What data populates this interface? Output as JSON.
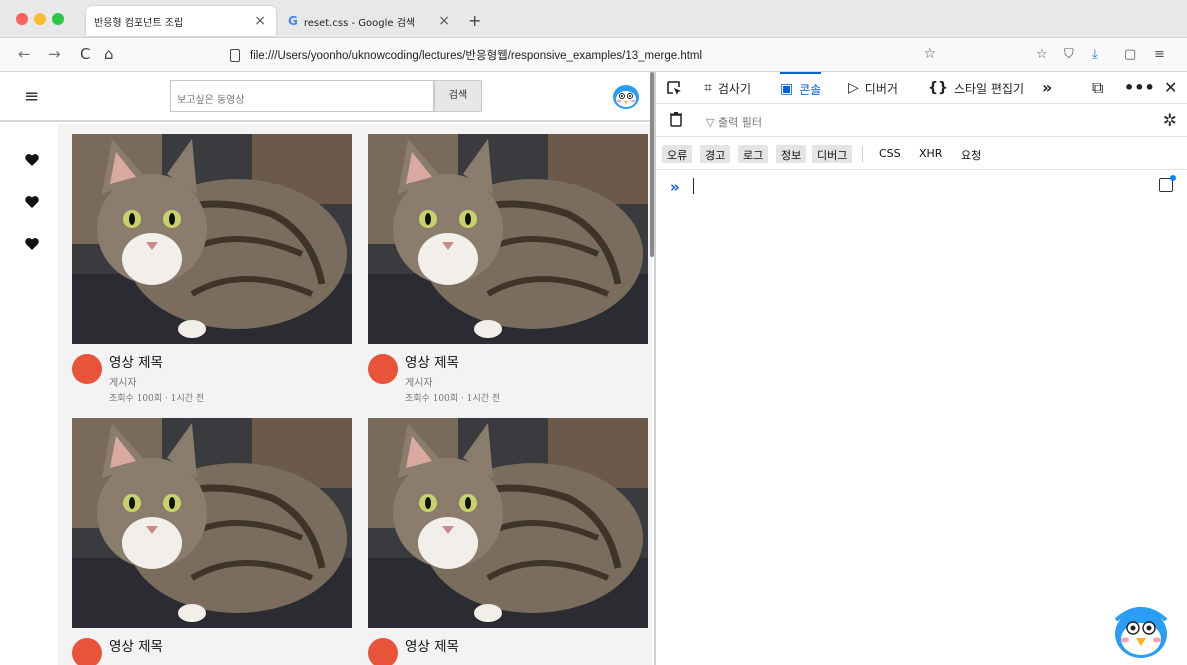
{
  "browser": {
    "tabs": [
      {
        "label": "반응형 컴포넌트 조립",
        "active": true
      },
      {
        "label": "reset.css - Google 검색",
        "active": false
      }
    ],
    "url": "file:///Users/yoonho/uknowcoding/lectures/반응형웹/responsive_examples/13_merge.html"
  },
  "page": {
    "search_placeholder": "보고싶은 동영상",
    "search_button": "검색",
    "cards": [
      {
        "title": "영상 제목",
        "author": "게시자",
        "info": "조회수 100회 · 1시간 전"
      },
      {
        "title": "영상 제목",
        "author": "게시자",
        "info": "조회수 100회 · 1시간 전"
      },
      {
        "title": "영상 제목",
        "author": "",
        "info": ""
      },
      {
        "title": "영상 제목",
        "author": "",
        "info": ""
      }
    ]
  },
  "devtools": {
    "tabs": {
      "inspector": "검사기",
      "console": "콘솔",
      "debugger": "디버거",
      "style_editor": "스타일 편집기"
    },
    "filter_placeholder": "출력 필터",
    "levels": [
      "오류",
      "경고",
      "로그",
      "정보",
      "디버그"
    ],
    "requests": [
      "CSS",
      "XHR",
      "요청"
    ],
    "prompt": "»"
  },
  "colors": {
    "accent": "#0060df",
    "avatar_dot": "#e8543a"
  }
}
